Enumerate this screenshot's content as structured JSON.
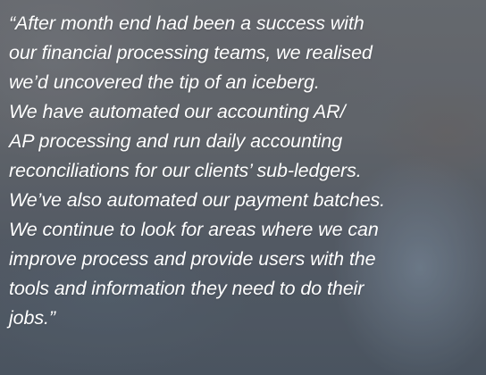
{
  "quote": {
    "lines": [
      "“After month end had been a success with",
      "our financial processing teams, we realised",
      "we’d uncovered the tip of an iceberg.",
      "We have automated our accounting AR/",
      "AP processing and run daily accounting",
      "reconciliations for our clients’ sub-ledgers.",
      "We’ve also automated our payment batches.",
      "We continue to look for areas where we can",
      "improve process and provide users with the",
      "tools and information they need to do their",
      "jobs.”"
    ]
  },
  "colors": {
    "text": "#ffffff"
  }
}
